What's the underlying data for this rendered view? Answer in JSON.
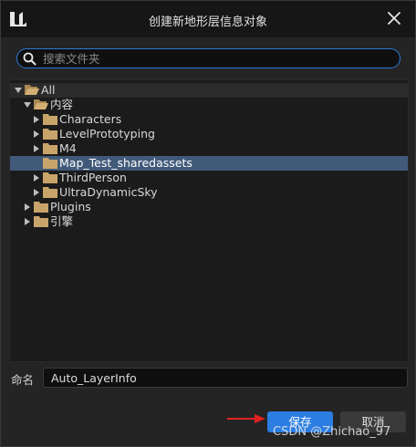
{
  "dialog": {
    "title": "创建新地形层信息对象",
    "logo_icon": "unreal-engine-logo-icon",
    "close_icon": "close-icon"
  },
  "search": {
    "placeholder": "搜索文件夹",
    "value": "",
    "icon": "search-icon",
    "accent_color": "#2d78d6"
  },
  "tree": {
    "items": [
      {
        "label": "All",
        "depth": 0,
        "expanded": true,
        "icon": "folder-open-icon",
        "has_children": true
      },
      {
        "label": "内容",
        "depth": 1,
        "expanded": true,
        "icon": "folder-open-icon",
        "has_children": true
      },
      {
        "label": "Characters",
        "depth": 2,
        "expanded": false,
        "icon": "folder-icon",
        "has_children": true
      },
      {
        "label": "LevelPrototyping",
        "depth": 2,
        "expanded": false,
        "icon": "folder-icon",
        "has_children": true
      },
      {
        "label": "M4",
        "depth": 2,
        "expanded": false,
        "icon": "folder-icon",
        "has_children": true
      },
      {
        "label": "Map_Test_sharedassets",
        "depth": 2,
        "expanded": false,
        "icon": "folder-icon",
        "has_children": false,
        "selected": true
      },
      {
        "label": "ThirdPerson",
        "depth": 2,
        "expanded": false,
        "icon": "folder-icon",
        "has_children": true
      },
      {
        "label": "UltraDynamicSky",
        "depth": 2,
        "expanded": false,
        "icon": "folder-icon",
        "has_children": true
      },
      {
        "label": "Plugins",
        "depth": 1,
        "expanded": false,
        "icon": "folder-icon",
        "has_children": true
      },
      {
        "label": "引擎",
        "depth": 1,
        "expanded": false,
        "icon": "folder-icon",
        "has_children": true
      }
    ],
    "selected_color": "#415a7a",
    "folder_color": "#c9a46a"
  },
  "name_field": {
    "label": "命名",
    "value": "Auto_LayerInfo"
  },
  "buttons": {
    "save": "保存",
    "cancel": "取消",
    "save_color": "#2b7de2"
  },
  "annotation": {
    "arrow_color": "#e02020"
  },
  "watermark": {
    "text": "CSDN @Zhichao_97"
  }
}
